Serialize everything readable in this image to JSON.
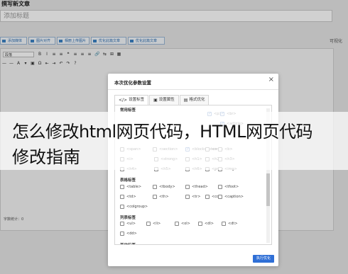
{
  "page": {
    "heading": "撰写新文章",
    "title_placeholder": "添加标题"
  },
  "plugin_bar": {
    "buttons": [
      "添加媒体",
      "图片对齐",
      "相册上传图片",
      "优化此篇文章",
      "优化此篇文章"
    ],
    "right_label": "可视化"
  },
  "editor": {
    "format_select": "段落",
    "row1_icons": [
      "B",
      "I",
      "≡",
      "≡",
      "❝",
      "≡",
      "≡",
      "≡",
      "🔗",
      "⇆",
      "⊞",
      "▦"
    ],
    "row2_icons": [
      "—",
      "—",
      "A",
      "▾",
      "▣",
      "Ω",
      "⇤",
      "⇥",
      "↶",
      "↷",
      "?"
    ],
    "word_count": "字数统计：0"
  },
  "dialog": {
    "title": "本次优化参数设置",
    "close_label": "×",
    "tabs": [
      {
        "icon": "</>",
        "label": "设置标签"
      },
      {
        "icon": "▣",
        "label": "设置属性"
      },
      {
        "icon": "▤",
        "label": "格式优化"
      }
    ],
    "groups": [
      {
        "title": "常用标签",
        "options": [
          {
            "label": "<p>",
            "checked": true
          },
          {
            "label": "<br>",
            "checked": true
          },
          {
            "label": "<article>",
            "checked": true
          },
          {
            "label": "<span>",
            "checked": false
          },
          {
            "label": "<section>",
            "checked": false
          },
          {
            "label": "<blockquote>",
            "checked": true
          },
          {
            "label": "<em>",
            "checked": false
          },
          {
            "label": "<b>",
            "checked": false
          },
          {
            "label": "<i>",
            "checked": false
          },
          {
            "label": "<strong>",
            "checked": false
          },
          {
            "label": "<h1>",
            "checked": false
          },
          {
            "label": "<h2>",
            "checked": false
          },
          {
            "label": "<h3>",
            "checked": false
          },
          {
            "label": "<h4>",
            "checked": false
          },
          {
            "label": "<h5>",
            "checked": false
          },
          {
            "label": "<h6>",
            "checked": false
          },
          {
            "label": "<pre>",
            "checked": false
          },
          {
            "label": "<img>",
            "checked": false
          },
          {
            "label": "<video>",
            "checked": false
          }
        ]
      },
      {
        "title": "表格标签",
        "options": [
          {
            "label": "<table>",
            "checked": false
          },
          {
            "label": "<tbody>",
            "checked": false
          },
          {
            "label": "<thead>",
            "checked": false
          },
          {
            "label": "<tfoot>",
            "checked": false
          },
          {
            "label": "<td>",
            "checked": false
          },
          {
            "label": "<th>",
            "checked": false
          },
          {
            "label": "<tr>",
            "checked": false
          },
          {
            "label": "<col>",
            "checked": false
          },
          {
            "label": "<caption>",
            "checked": false
          },
          {
            "label": "<colgroup>",
            "checked": false
          }
        ]
      },
      {
        "title": "列表标签",
        "options": [
          {
            "label": "<ul>",
            "checked": false
          },
          {
            "label": "<li>",
            "checked": false
          },
          {
            "label": "<ol>",
            "checked": false
          },
          {
            "label": "<dl>",
            "checked": false
          },
          {
            "label": "<dt>",
            "checked": false
          },
          {
            "label": "<dd>",
            "checked": false
          }
        ]
      },
      {
        "title": "其他标签",
        "options": []
      }
    ],
    "execute_button": "执行优化"
  },
  "banner": {
    "line1": "怎么修改html网页代码，HTML网页代码",
    "line2": "修改指南"
  },
  "colors": {
    "accent": "#2f6fd6",
    "overlay": "#000000"
  }
}
